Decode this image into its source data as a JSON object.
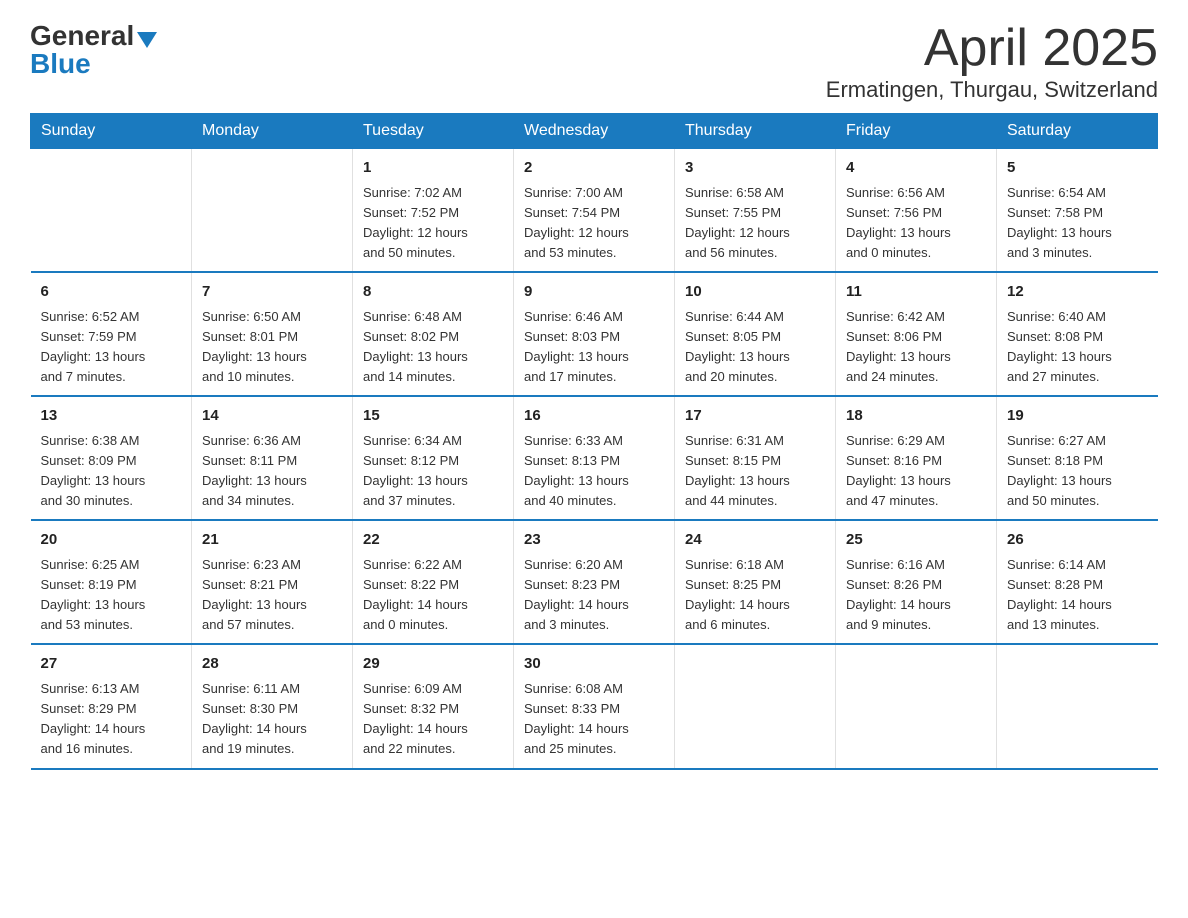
{
  "logo": {
    "general": "General",
    "blue": "Blue"
  },
  "title": {
    "month_year": "April 2025",
    "location": "Ermatingen, Thurgau, Switzerland"
  },
  "days_of_week": [
    "Sunday",
    "Monday",
    "Tuesday",
    "Wednesday",
    "Thursday",
    "Friday",
    "Saturday"
  ],
  "weeks": [
    [
      {
        "day": "",
        "info": ""
      },
      {
        "day": "",
        "info": ""
      },
      {
        "day": "1",
        "info": "Sunrise: 7:02 AM\nSunset: 7:52 PM\nDaylight: 12 hours\nand 50 minutes."
      },
      {
        "day": "2",
        "info": "Sunrise: 7:00 AM\nSunset: 7:54 PM\nDaylight: 12 hours\nand 53 minutes."
      },
      {
        "day": "3",
        "info": "Sunrise: 6:58 AM\nSunset: 7:55 PM\nDaylight: 12 hours\nand 56 minutes."
      },
      {
        "day": "4",
        "info": "Sunrise: 6:56 AM\nSunset: 7:56 PM\nDaylight: 13 hours\nand 0 minutes."
      },
      {
        "day": "5",
        "info": "Sunrise: 6:54 AM\nSunset: 7:58 PM\nDaylight: 13 hours\nand 3 minutes."
      }
    ],
    [
      {
        "day": "6",
        "info": "Sunrise: 6:52 AM\nSunset: 7:59 PM\nDaylight: 13 hours\nand 7 minutes."
      },
      {
        "day": "7",
        "info": "Sunrise: 6:50 AM\nSunset: 8:01 PM\nDaylight: 13 hours\nand 10 minutes."
      },
      {
        "day": "8",
        "info": "Sunrise: 6:48 AM\nSunset: 8:02 PM\nDaylight: 13 hours\nand 14 minutes."
      },
      {
        "day": "9",
        "info": "Sunrise: 6:46 AM\nSunset: 8:03 PM\nDaylight: 13 hours\nand 17 minutes."
      },
      {
        "day": "10",
        "info": "Sunrise: 6:44 AM\nSunset: 8:05 PM\nDaylight: 13 hours\nand 20 minutes."
      },
      {
        "day": "11",
        "info": "Sunrise: 6:42 AM\nSunset: 8:06 PM\nDaylight: 13 hours\nand 24 minutes."
      },
      {
        "day": "12",
        "info": "Sunrise: 6:40 AM\nSunset: 8:08 PM\nDaylight: 13 hours\nand 27 minutes."
      }
    ],
    [
      {
        "day": "13",
        "info": "Sunrise: 6:38 AM\nSunset: 8:09 PM\nDaylight: 13 hours\nand 30 minutes."
      },
      {
        "day": "14",
        "info": "Sunrise: 6:36 AM\nSunset: 8:11 PM\nDaylight: 13 hours\nand 34 minutes."
      },
      {
        "day": "15",
        "info": "Sunrise: 6:34 AM\nSunset: 8:12 PM\nDaylight: 13 hours\nand 37 minutes."
      },
      {
        "day": "16",
        "info": "Sunrise: 6:33 AM\nSunset: 8:13 PM\nDaylight: 13 hours\nand 40 minutes."
      },
      {
        "day": "17",
        "info": "Sunrise: 6:31 AM\nSunset: 8:15 PM\nDaylight: 13 hours\nand 44 minutes."
      },
      {
        "day": "18",
        "info": "Sunrise: 6:29 AM\nSunset: 8:16 PM\nDaylight: 13 hours\nand 47 minutes."
      },
      {
        "day": "19",
        "info": "Sunrise: 6:27 AM\nSunset: 8:18 PM\nDaylight: 13 hours\nand 50 minutes."
      }
    ],
    [
      {
        "day": "20",
        "info": "Sunrise: 6:25 AM\nSunset: 8:19 PM\nDaylight: 13 hours\nand 53 minutes."
      },
      {
        "day": "21",
        "info": "Sunrise: 6:23 AM\nSunset: 8:21 PM\nDaylight: 13 hours\nand 57 minutes."
      },
      {
        "day": "22",
        "info": "Sunrise: 6:22 AM\nSunset: 8:22 PM\nDaylight: 14 hours\nand 0 minutes."
      },
      {
        "day": "23",
        "info": "Sunrise: 6:20 AM\nSunset: 8:23 PM\nDaylight: 14 hours\nand 3 minutes."
      },
      {
        "day": "24",
        "info": "Sunrise: 6:18 AM\nSunset: 8:25 PM\nDaylight: 14 hours\nand 6 minutes."
      },
      {
        "day": "25",
        "info": "Sunrise: 6:16 AM\nSunset: 8:26 PM\nDaylight: 14 hours\nand 9 minutes."
      },
      {
        "day": "26",
        "info": "Sunrise: 6:14 AM\nSunset: 8:28 PM\nDaylight: 14 hours\nand 13 minutes."
      }
    ],
    [
      {
        "day": "27",
        "info": "Sunrise: 6:13 AM\nSunset: 8:29 PM\nDaylight: 14 hours\nand 16 minutes."
      },
      {
        "day": "28",
        "info": "Sunrise: 6:11 AM\nSunset: 8:30 PM\nDaylight: 14 hours\nand 19 minutes."
      },
      {
        "day": "29",
        "info": "Sunrise: 6:09 AM\nSunset: 8:32 PM\nDaylight: 14 hours\nand 22 minutes."
      },
      {
        "day": "30",
        "info": "Sunrise: 6:08 AM\nSunset: 8:33 PM\nDaylight: 14 hours\nand 25 minutes."
      },
      {
        "day": "",
        "info": ""
      },
      {
        "day": "",
        "info": ""
      },
      {
        "day": "",
        "info": ""
      }
    ]
  ]
}
